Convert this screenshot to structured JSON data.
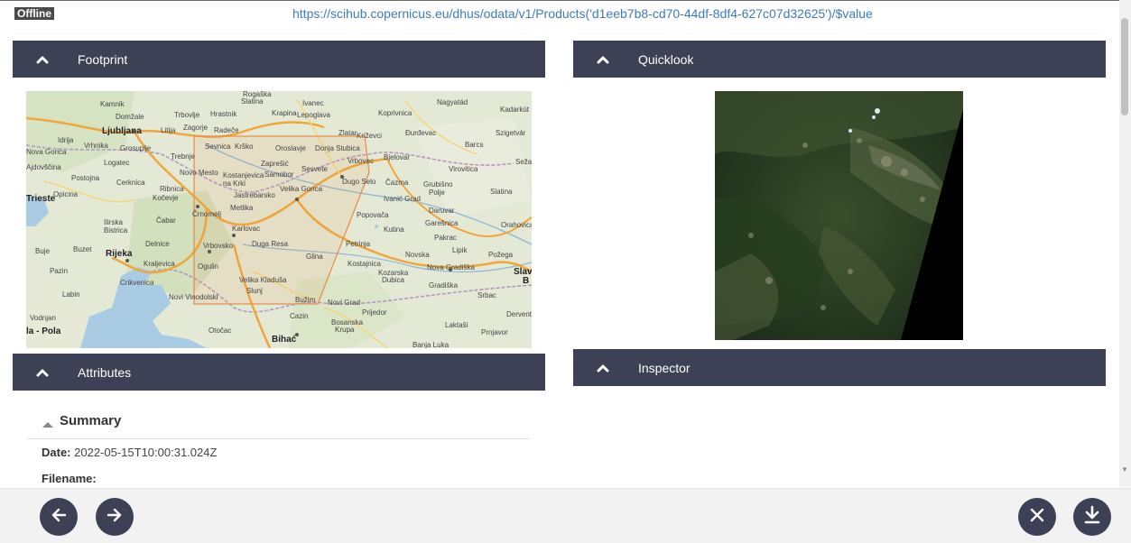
{
  "status_badge": "Offline",
  "product_url": "https://scihub.copernicus.eu/dhus/odata/v1/Products('d1eeb7b8-cd70-44df-8df4-627c07d32625')/$value",
  "panels": {
    "footprint": "Footprint",
    "quicklook": "Quicklook",
    "attributes": "Attributes",
    "inspector": "Inspector"
  },
  "map": {
    "place_labels": [
      "Rogaška Slatina",
      "Ivanec",
      "Krapina",
      "Lepoglava",
      "Kamnik",
      "Domžale",
      "Trbovlje",
      "Hrastnik",
      "Zagorje",
      "Radeče",
      "Zabok",
      "Zlatar",
      "Koprivnica",
      "Nagyatád",
      "Kadarkút",
      "Ljubljana",
      "Litija",
      "Idrija",
      "Vrhnika",
      "Grosuplje",
      "Sevnica",
      "Krško",
      "Oroslavje",
      "Donja Stubica",
      "Križevci",
      "Đurđevac",
      "Szigetvár",
      "Nova Gorica",
      "Ajdovščina",
      "Logatec",
      "Trebnje",
      "Brežice",
      "Zaprešić",
      "Vrbovec",
      "Bjelovar",
      "Barcs",
      "Postojna",
      "Cerknica",
      "Novo Mesto",
      "Kostanjevica na Krki",
      "Samobor",
      "Sesvete",
      "Dugo Selo",
      "Čazma",
      "Virovitica",
      "Sežana",
      "Kočevje",
      "Ribnica",
      "Jastrebarsko",
      "Velika Gorica",
      "Ivanić Grad",
      "Grubišno Polje",
      "Slatina",
      "Trieste",
      "Opicina",
      "Metlika",
      "Popovača",
      "Daruvar",
      "Ilirska Bistrica",
      "Čabar",
      "Črnomelj",
      "Karlovac",
      "Kutina",
      "Garešnica",
      "Orahovica",
      "Delnice",
      "Vrbovsko",
      "Duga Resa",
      "Petrinja",
      "Pakrac",
      "Buje",
      "Buzet",
      "Rijeka",
      "Glina",
      "Novska",
      "Lipik",
      "Požega",
      "Kraljevica",
      "Ogulin",
      "Kostajnica",
      "Kozarska Dubica",
      "Nova Gradiška",
      "Pazin",
      "Crikvenica",
      "Velika Kladuša",
      "Gradiška",
      "Srbac",
      "Labin",
      "Novi Vinodolski",
      "Slunj",
      "Bužim",
      "Novi Grad",
      "Prijedor",
      "Derventa",
      "Vodnjan",
      "Cazin",
      "Bosanska Krupa",
      "Laktaši",
      "Prnjavor",
      "Pula",
      "Otočac",
      "Bihać",
      "Banja Luka",
      "Slav. Brod"
    ]
  },
  "summary": {
    "title": "Summary",
    "date_label": "Date:",
    "date_value": "2022-05-15T10:00:31.024Z",
    "filename_label": "Filename:"
  },
  "icons": {
    "collapse": "chevron-up-icon",
    "back": "arrow-left-icon",
    "forward": "arrow-right-icon",
    "close": "close-icon",
    "download": "download-icon"
  },
  "colors": {
    "header_bg": "#3c4155",
    "link": "#3b7bbf",
    "footprint_outline": "#e8904a"
  }
}
